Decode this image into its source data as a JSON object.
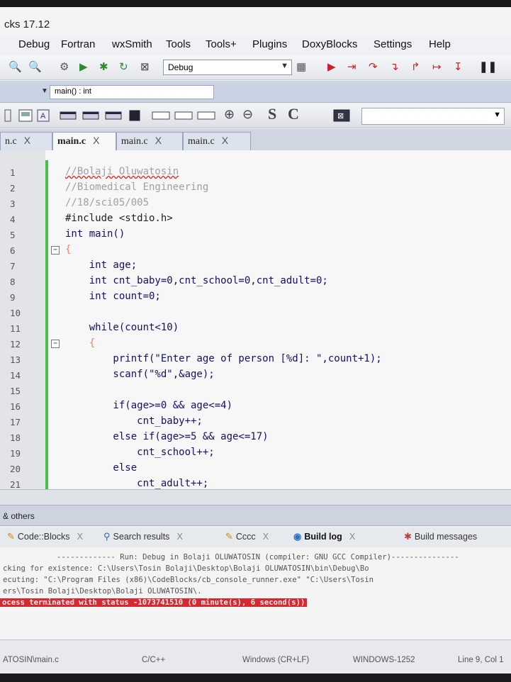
{
  "window": {
    "title": "cks 17.12"
  },
  "menu": [
    "Debug",
    "Fortran",
    "wxSmith",
    "Tools",
    "Tools+",
    "Plugins",
    "DoxyBlocks",
    "Settings",
    "Help"
  ],
  "toolbar": {
    "build_target": "Debug"
  },
  "code_nav": {
    "scope": "main() : int"
  },
  "toolbar2": {
    "s_label": "S",
    "c_label": "C"
  },
  "tabs": [
    {
      "label": "n.c",
      "close": "X",
      "active": false
    },
    {
      "label": "main.c",
      "close": "X",
      "active": true
    },
    {
      "label": "main.c",
      "close": "X",
      "active": false
    },
    {
      "label": "main.c",
      "close": "X",
      "active": false
    }
  ],
  "editor": {
    "lines": [
      {
        "n": "1",
        "text": "//Bolaji Oluwatosin"
      },
      {
        "n": "2",
        "text": "//Biomedical Engineering"
      },
      {
        "n": "3",
        "text": "//18/sci05/005"
      },
      {
        "n": "4",
        "text": "#include <stdio.h>"
      },
      {
        "n": "5",
        "text": "int main()"
      },
      {
        "n": "6",
        "text": "{"
      },
      {
        "n": "7",
        "text": "    int age;"
      },
      {
        "n": "8",
        "text": "    int cnt_baby=0,cnt_school=0,cnt_adult=0;"
      },
      {
        "n": "9",
        "text": "    int count=0;"
      },
      {
        "n": "10",
        "text": ""
      },
      {
        "n": "11",
        "text": "    while(count<10)"
      },
      {
        "n": "12",
        "text": "    {"
      },
      {
        "n": "13",
        "text": "        printf(\"Enter age of person [%d]: \",count+1);"
      },
      {
        "n": "14",
        "text": "        scanf(\"%d\",&age);"
      },
      {
        "n": "15",
        "text": ""
      },
      {
        "n": "16",
        "text": "        if(age>=0 && age<=4)"
      },
      {
        "n": "17",
        "text": "            cnt_baby++;"
      },
      {
        "n": "18",
        "text": "        else if(age>=5 && age<=17)"
      },
      {
        "n": "19",
        "text": "            cnt_school++;"
      },
      {
        "n": "20",
        "text": "        else"
      },
      {
        "n": "21",
        "text": "            cnt_adult++;"
      }
    ]
  },
  "bottom": {
    "panel_title": "& others",
    "log_tabs": [
      {
        "label": "Code::Blocks",
        "close": "X",
        "active": false
      },
      {
        "label": "Search results",
        "close": "X",
        "active": false
      },
      {
        "label": "Cccc",
        "close": "X",
        "active": false
      },
      {
        "label": "Build log",
        "close": "X",
        "active": true
      },
      {
        "label": "Build messages",
        "close": "",
        "active": false
      }
    ],
    "log_lines": [
      "------------- Run: Debug in Bolaji OLUWATOSIN (compiler: GNU GCC Compiler)---------------",
      "cking for existence: C:\\Users\\Tosin Bolaji\\Desktop\\Bolaji OLUWATOSIN\\bin\\Debug\\Bo",
      "ecuting: \"C:\\Program Files (x86)\\CodeBlocks/cb_console_runner.exe\" \"C:\\Users\\Tosin",
      "ers\\Tosin Bolaji\\Desktop\\Bolaji OLUWATOSIN\\.",
      "ocess terminated with status -1073741510 (0 minute(s), 6 second(s))"
    ]
  },
  "status": {
    "file": "ATOSIN\\main.c",
    "lang": "C/C++",
    "eol": "Windows (CR+LF)",
    "encoding": "WINDOWS-1252",
    "position": "Line 9, Col 1"
  }
}
